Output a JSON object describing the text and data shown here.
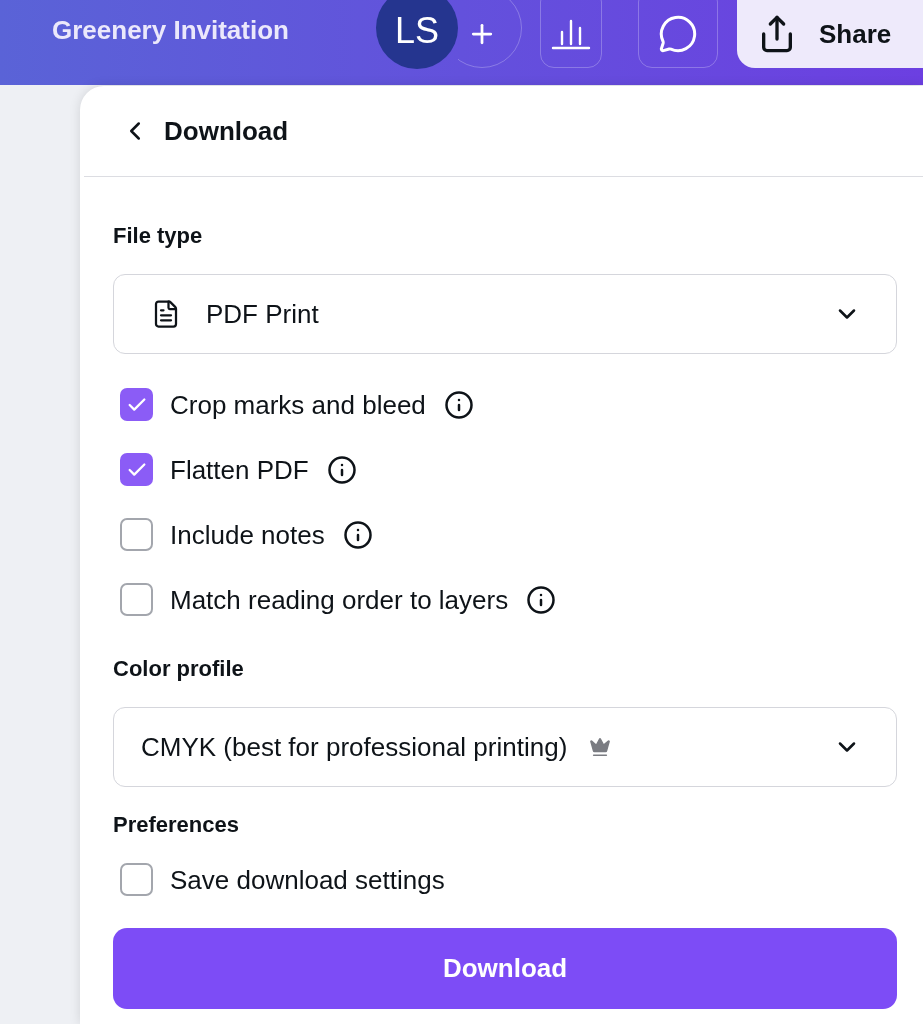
{
  "top_bar": {
    "title": "Greenery Invitation",
    "avatar": {
      "initials": "LS"
    },
    "share_button": {
      "label": "Share"
    }
  },
  "download_panel": {
    "title": "Download",
    "file_type": {
      "label": "File type",
      "value": "PDF Print"
    },
    "options": [
      {
        "label": "Crop marks and bleed",
        "checked": true
      },
      {
        "label": "Flatten PDF",
        "checked": true
      },
      {
        "label": "Include notes",
        "checked": false
      },
      {
        "label": "Match reading order to layers",
        "checked": false
      }
    ],
    "color_profile": {
      "label": "Color profile",
      "value": "CMYK (best for professional printing)"
    },
    "preferences": {
      "label": "Preferences",
      "options": [
        {
          "label": "Save download settings",
          "checked": false
        }
      ]
    },
    "download_button": {
      "label": "Download"
    }
  }
}
